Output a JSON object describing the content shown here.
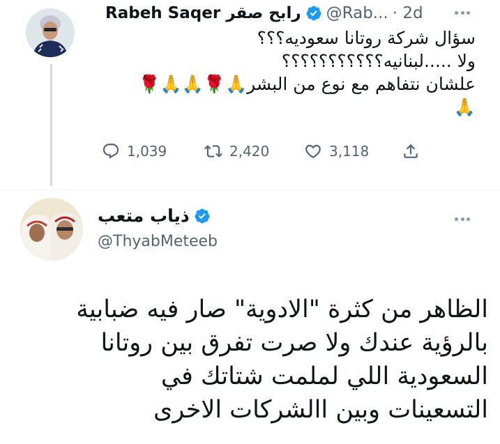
{
  "tweet1": {
    "name": "Rabeh Saqer رابح صقر",
    "handle": "@Rab...",
    "time": "· 2d",
    "lines": [
      "سؤال شركة روتانا سعوديه؟؟؟",
      "ولا .....لبنانيه؟؟؟؟؟؟؟؟؟؟؟",
      "علشان نتفاهم   مع نوع من البشر🙏🌹🙏🙏🌹",
      "🙏"
    ],
    "stats": {
      "replies": "1,039",
      "retweets": "2,420",
      "likes": "3,118"
    }
  },
  "tweet2": {
    "name": "ذياب متعب",
    "handle": "@ThyabMeteeb",
    "lines": [
      "الظاهر من كثرة \"الادوية\" صار فيه ضبابية",
      "بالرؤية عندك ولا صرت تفرق بين روتانا",
      "السعودية اللي لملمت شتاتك في",
      "التسعينات وبين اا‎لشركات الاخرى"
    ]
  },
  "colors": {
    "verified": "#1d9bf0",
    "muted": "#536471",
    "text": "#0f1419"
  },
  "icons": [
    "reply-icon",
    "retweet-icon",
    "like-icon",
    "share-icon",
    "verified-badge-icon",
    "more-icon"
  ]
}
